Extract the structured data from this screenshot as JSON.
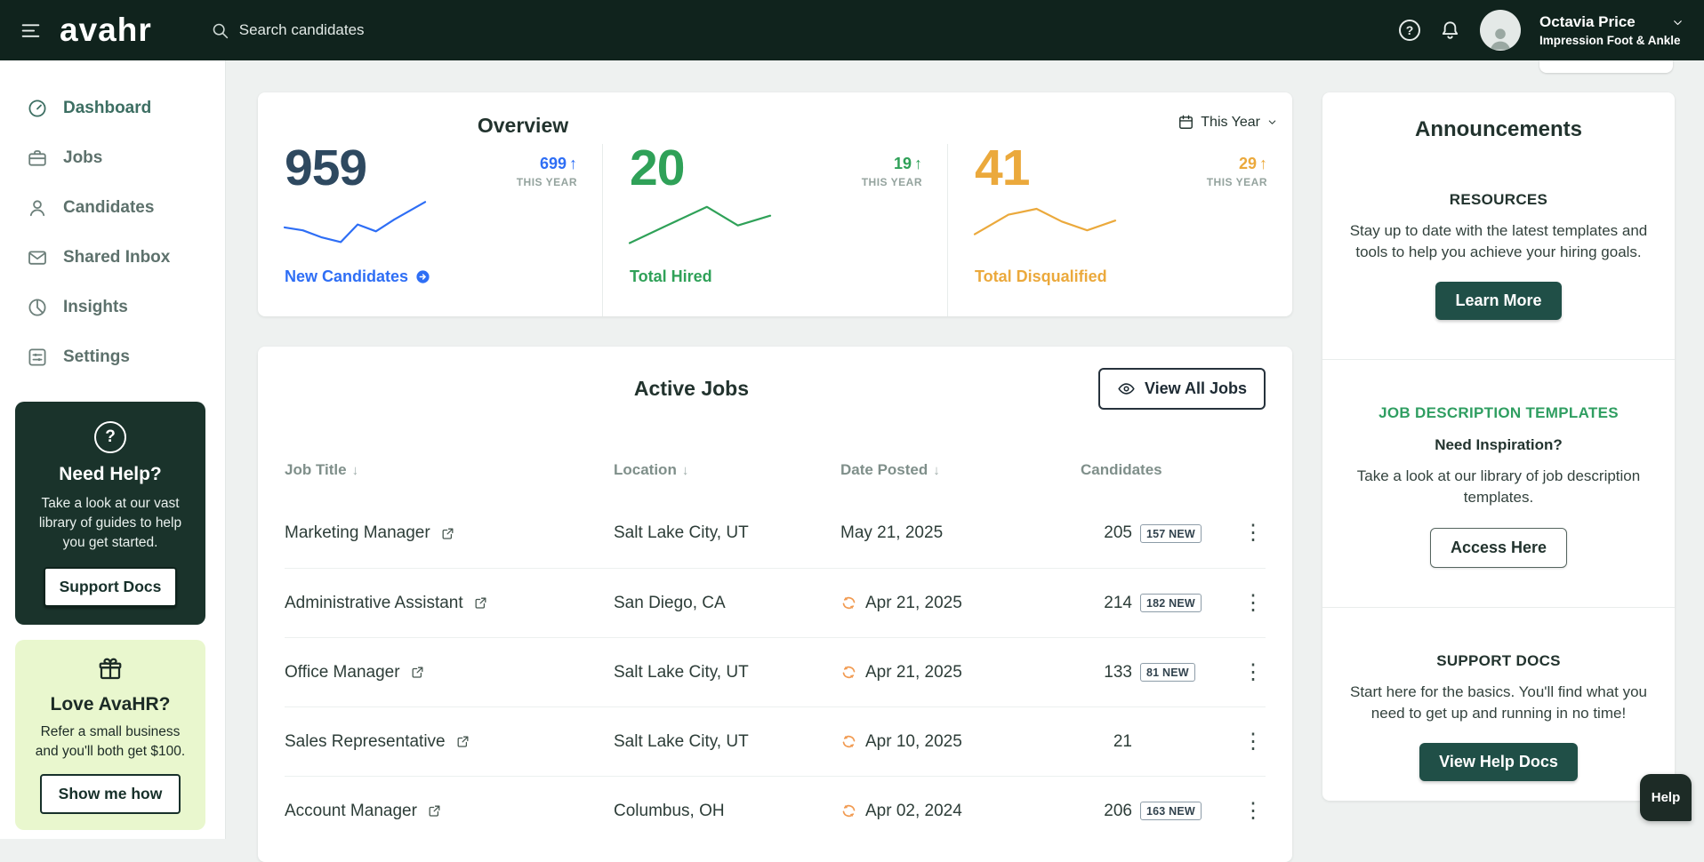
{
  "theme": {
    "topbar_bg": "#10231d",
    "page_bg": "#eef1f0",
    "card_bg": "#ffffff",
    "primary_button": "#204f47",
    "accent_blue": "#2e6ef5",
    "accent_green": "#2fa158",
    "accent_amber": "#eba93c",
    "stat_navy": "#2e4960"
  },
  "topbar": {
    "logo": "avahr",
    "search_placeholder": "Search candidates",
    "user": {
      "name": "Octavia Price",
      "org": "Impression Foot & Ankle"
    }
  },
  "sidebar": {
    "items": [
      {
        "label": "Dashboard"
      },
      {
        "label": "Jobs"
      },
      {
        "label": "Candidates"
      },
      {
        "label": "Shared Inbox"
      },
      {
        "label": "Insights"
      },
      {
        "label": "Settings"
      }
    ],
    "help_card": {
      "title": "Need Help?",
      "body": "Take a look at our vast library of guides to help you get started.",
      "button": "Support Docs"
    },
    "referral_card": {
      "title": "Love AvaHR?",
      "body": "Refer a small business and you'll both get $100.",
      "button": "Show me how"
    }
  },
  "overview": {
    "title": "Overview",
    "period": "This Year",
    "stats": [
      {
        "value": "959",
        "value_color": "#2e4960",
        "delta": "699",
        "delta_color": "#2e6ef5",
        "delta_caption": "THIS YEAR",
        "label": "New Candidates",
        "accent": "#2e6ef5",
        "sparkline": [
          [
            0,
            58
          ],
          [
            13,
            64
          ],
          [
            26,
            78
          ],
          [
            40,
            88
          ],
          [
            52,
            52
          ],
          [
            65,
            66
          ],
          [
            78,
            42
          ],
          [
            100,
            6
          ]
        ]
      },
      {
        "value": "20",
        "value_color": "#2fa158",
        "delta": "19",
        "delta_color": "#2fa158",
        "delta_caption": "THIS YEAR",
        "label": "Total Hired",
        "accent": "#2fa158",
        "sparkline": [
          [
            0,
            90
          ],
          [
            28,
            52
          ],
          [
            55,
            16
          ],
          [
            77,
            54
          ],
          [
            100,
            34
          ]
        ]
      },
      {
        "value": "41",
        "value_color": "#eba93c",
        "delta": "29",
        "delta_color": "#eba93c",
        "delta_caption": "THIS YEAR",
        "label": "Total Disqualified",
        "accent": "#eba93c",
        "sparkline": [
          [
            0,
            72
          ],
          [
            24,
            32
          ],
          [
            44,
            20
          ],
          [
            62,
            46
          ],
          [
            80,
            64
          ],
          [
            100,
            44
          ]
        ]
      }
    ]
  },
  "active_jobs": {
    "title": "Active Jobs",
    "view_all": "View All Jobs",
    "columns": [
      "Job Title",
      "Location",
      "Date Posted",
      "Candidates"
    ],
    "rows": [
      {
        "title": "Marketing Manager",
        "location": "Salt Lake City, UT",
        "date": "May 21, 2025",
        "reposted": false,
        "candidates": "205",
        "new_badge": "157 NEW"
      },
      {
        "title": "Administrative Assistant",
        "location": "San Diego, CA",
        "date": "Apr 21, 2025",
        "reposted": true,
        "candidates": "214",
        "new_badge": "182 NEW"
      },
      {
        "title": "Office Manager",
        "location": "Salt Lake City, UT",
        "date": "Apr 21, 2025",
        "reposted": true,
        "candidates": "133",
        "new_badge": "81 NEW"
      },
      {
        "title": "Sales Representative",
        "location": "Salt Lake City, UT",
        "date": "Apr 10, 2025",
        "reposted": true,
        "candidates": "21",
        "new_badge": ""
      },
      {
        "title": "Account Manager",
        "location": "Columbus, OH",
        "date": "Apr 02, 2024",
        "reposted": true,
        "candidates": "206",
        "new_badge": "163 NEW"
      }
    ]
  },
  "announcements": {
    "title": "Announcements",
    "resources": {
      "heading": "RESOURCES",
      "body": "Stay up to date with the latest templates and tools to help you achieve your hiring goals.",
      "button": "Learn More"
    },
    "templates": {
      "heading": "JOB DESCRIPTION TEMPLATES",
      "heading_color": "#2f9e61",
      "subheading": "Need Inspiration?",
      "body": "Take a look at our library of job description templates.",
      "button": "Access Here"
    },
    "support": {
      "heading": "SUPPORT DOCS",
      "body": "Start here for the basics. You'll find what you need to get up and running in no time!",
      "button": "View Help Docs"
    }
  },
  "help_button": "Help"
}
